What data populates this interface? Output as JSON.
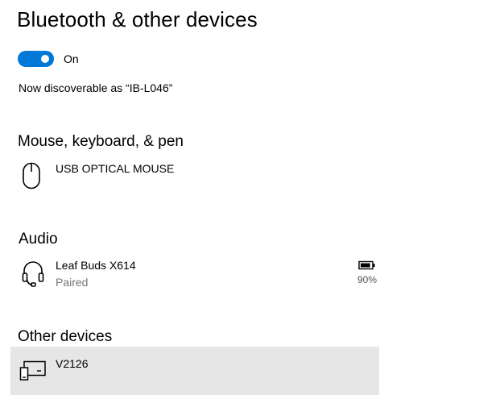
{
  "header": {
    "title": "Bluetooth & other devices"
  },
  "bluetooth": {
    "toggle_state": "on",
    "toggle_label": "On",
    "discoverable_text": "Now discoverable as “IB-L046”",
    "accent_color": "#0078d7"
  },
  "sections": {
    "mouse": {
      "title": "Mouse, keyboard, & pen",
      "devices": [
        {
          "name": "USB OPTICAL MOUSE",
          "icon": "mouse-icon"
        }
      ]
    },
    "audio": {
      "title": "Audio",
      "devices": [
        {
          "name": "Leaf Buds X614",
          "status": "Paired",
          "icon": "headset-icon",
          "battery_label": "90%",
          "battery_level": 0.9
        }
      ]
    },
    "other": {
      "title": "Other devices",
      "devices": [
        {
          "name": "V2126",
          "icon": "display-device-icon",
          "selected": true
        }
      ]
    }
  }
}
